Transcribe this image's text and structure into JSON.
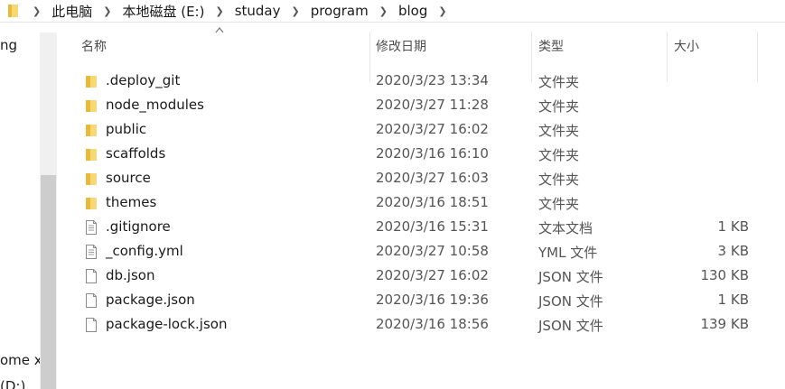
{
  "breadcrumb": [
    "此电脑",
    "本地磁盘 (E:)",
    "studay",
    "program",
    "blog"
  ],
  "nav_fragments": [
    "ng",
    "ome x",
    "(D:)"
  ],
  "columns": {
    "name": "名称",
    "date": "修改日期",
    "type": "类型",
    "size": "大小"
  },
  "sort": {
    "column": "name",
    "direction": "ascending"
  },
  "files": [
    {
      "name": ".deploy_git",
      "date": "2020/3/23 13:34",
      "type": "文件夹",
      "size": "",
      "icon": "folder-icon"
    },
    {
      "name": "node_modules",
      "date": "2020/3/27 11:28",
      "type": "文件夹",
      "size": "",
      "icon": "folder-icon"
    },
    {
      "name": "public",
      "date": "2020/3/27 16:02",
      "type": "文件夹",
      "size": "",
      "icon": "folder-icon"
    },
    {
      "name": "scaffolds",
      "date": "2020/3/16 16:10",
      "type": "文件夹",
      "size": "",
      "icon": "folder-icon"
    },
    {
      "name": "source",
      "date": "2020/3/27 16:03",
      "type": "文件夹",
      "size": "",
      "icon": "folder-icon"
    },
    {
      "name": "themes",
      "date": "2020/3/16 18:51",
      "type": "文件夹",
      "size": "",
      "icon": "folder-icon"
    },
    {
      "name": ".gitignore",
      "date": "2020/3/16 15:31",
      "type": "文本文档",
      "size": "1 KB",
      "icon": "text-file-icon"
    },
    {
      "name": "_config.yml",
      "date": "2020/3/27 10:58",
      "type": "YML 文件",
      "size": "3 KB",
      "icon": "text-file-icon"
    },
    {
      "name": "db.json",
      "date": "2020/3/27 16:02",
      "type": "JSON 文件",
      "size": "130 KB",
      "icon": "file-icon"
    },
    {
      "name": "package.json",
      "date": "2020/3/16 19:36",
      "type": "JSON 文件",
      "size": "1 KB",
      "icon": "file-icon"
    },
    {
      "name": "package-lock.json",
      "date": "2020/3/16 18:56",
      "type": "JSON 文件",
      "size": "139 KB",
      "icon": "file-icon"
    }
  ],
  "colors": {
    "folder": "#f8d775",
    "folder_dark": "#e8b93a",
    "file_border": "#8a8a8a"
  }
}
